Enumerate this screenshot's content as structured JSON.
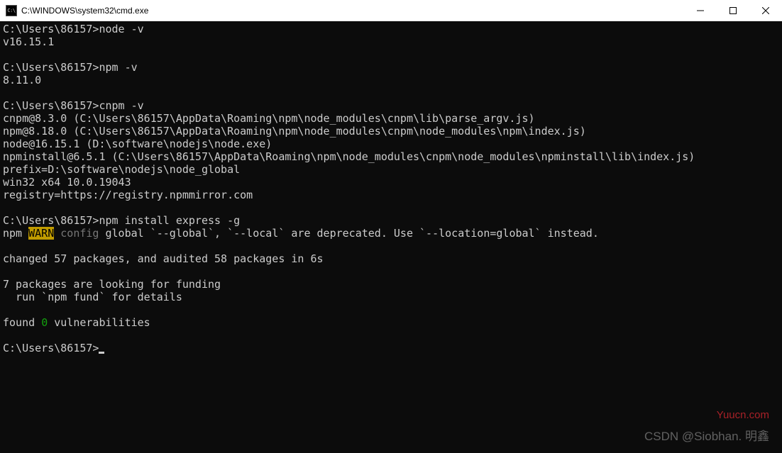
{
  "window": {
    "icon_text": "C:\\",
    "title": "C:\\WINDOWS\\system32\\cmd.exe"
  },
  "terminal": {
    "prompt": "C:\\Users\\86157>",
    "cmd1": "node -v",
    "out1": "v16.15.1",
    "cmd2": "npm -v",
    "out2": "8.11.0",
    "cmd3": "cnpm -v",
    "out3_l1": "cnpm@8.3.0 (C:\\Users\\86157\\AppData\\Roaming\\npm\\node_modules\\cnpm\\lib\\parse_argv.js)",
    "out3_l2": "npm@8.18.0 (C:\\Users\\86157\\AppData\\Roaming\\npm\\node_modules\\cnpm\\node_modules\\npm\\index.js)",
    "out3_l3": "node@16.15.1 (D:\\software\\nodejs\\node.exe)",
    "out3_l4": "npminstall@6.5.1 (C:\\Users\\86157\\AppData\\Roaming\\npm\\node_modules\\cnpm\\node_modules\\npminstall\\lib\\index.js)",
    "out3_l5": "prefix=D:\\software\\nodejs\\node_global",
    "out3_l6": "win32 x64 10.0.19043",
    "out3_l7": "registry=https://registry.npmmirror.com",
    "cmd4": "npm install express -g",
    "warn_prefix": "npm ",
    "warn_tag": "WARN",
    "warn_space": " ",
    "warn_config": "config",
    "warn_rest": " global `--global`, `--local` are deprecated. Use `--location=global` instead.",
    "out4_l1": "changed 57 packages, and audited 58 packages in 6s",
    "out4_l2": "7 packages are looking for funding",
    "out4_l3": "  run `npm fund` for details",
    "vuln_prefix": "found ",
    "vuln_zero": "0",
    "vuln_suffix": " vulnerabilities"
  },
  "watermarks": {
    "w1": "Yuucn.com",
    "w2": "CSDN @Siobhan. 明鑫"
  }
}
